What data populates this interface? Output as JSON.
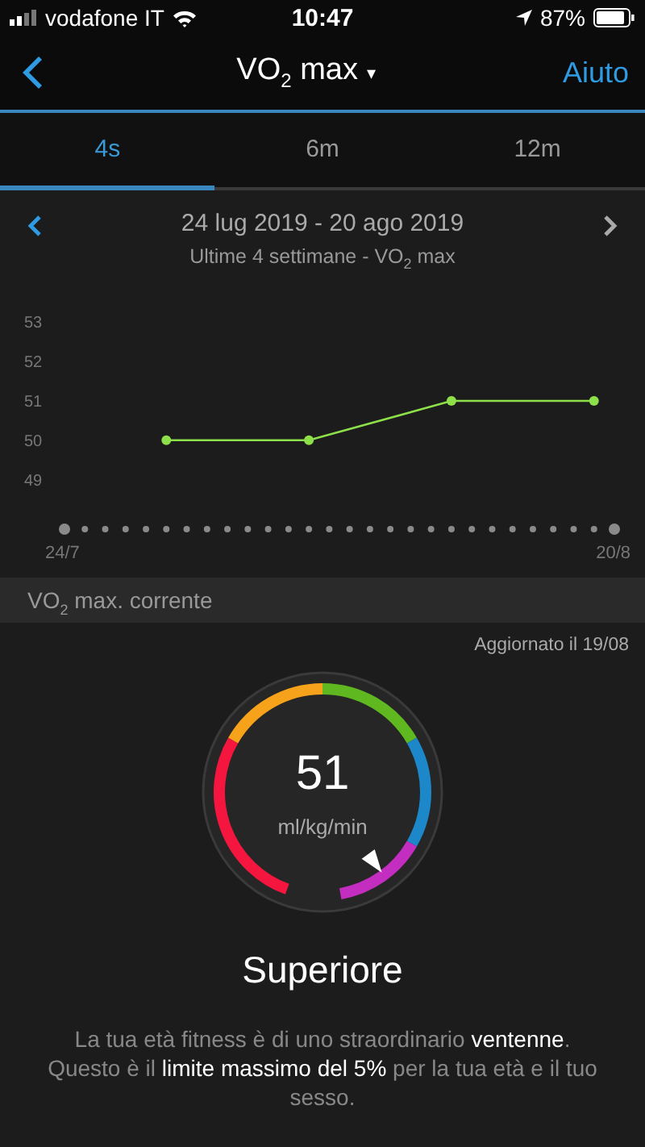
{
  "status_bar": {
    "carrier": "vodafone IT",
    "time": "10:47",
    "battery": "87%"
  },
  "nav": {
    "title": "VO$_{2}$ max",
    "menu_glyph": "▾",
    "help": "Aiuto"
  },
  "tabs": [
    {
      "label": "4s",
      "selected": true
    },
    {
      "label": "6m",
      "selected": false
    },
    {
      "label": "12m",
      "selected": false
    }
  ],
  "period": {
    "range": "24 lug 2019 - 20 ago 2019",
    "subtitle": "Ultime 4 settimane - VO$_{2}$ max"
  },
  "chart": {
    "chart_data": {
      "type": "line",
      "categories": [
        "24/7",
        null,
        null,
        null,
        null,
        null,
        null,
        null,
        null,
        null,
        null,
        null,
        null,
        null,
        null,
        null,
        null,
        null,
        null,
        null,
        null,
        null,
        null,
        null,
        null,
        null,
        null,
        "20/8"
      ],
      "ylim": [
        49,
        53
      ],
      "yticks": [
        49,
        50,
        51,
        52,
        53
      ],
      "series": [
        {
          "color": "#8ee04a",
          "marker": "circle",
          "values": [
            null,
            null,
            null,
            null,
            null,
            50,
            null,
            null,
            null,
            null,
            null,
            null,
            50,
            null,
            null,
            null,
            null,
            null,
            null,
            51,
            null,
            null,
            null,
            null,
            null,
            null,
            51,
            null
          ]
        }
      ]
    }
  },
  "section_header": "VO$_{2}$ max. corrente",
  "updated": "Aggiornato il 19/08",
  "gauge": {
    "value": "51",
    "unit": "ml/kg/min",
    "zones": [
      {
        "color": "#f5163f"
      },
      {
        "color": "#f7a21b"
      },
      {
        "color": "#5fb820"
      },
      {
        "color": "#1d88c9"
      },
      {
        "color": "#c42ec0"
      }
    ]
  },
  "rating": "Superiore",
  "description": "La tua età fitness è di uno straordinario **ventenne**. Questo è il **limite massimo del 5%** per la tua età e il tuo sesso."
}
